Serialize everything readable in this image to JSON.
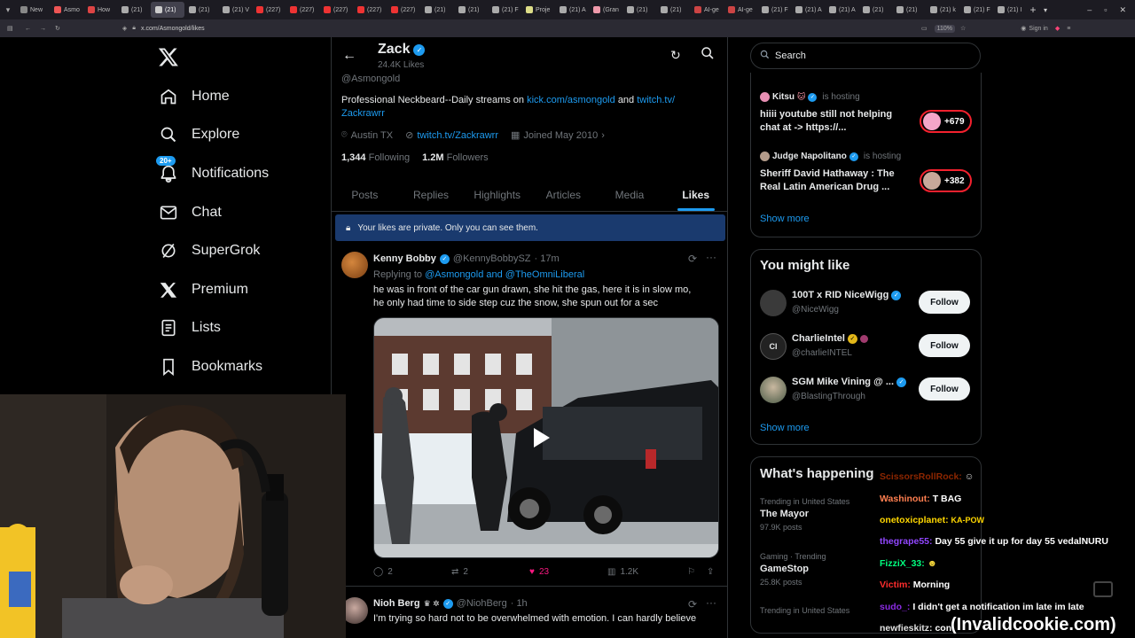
{
  "browser": {
    "tabs": [
      "New",
      "Asmo",
      "How",
      "(21)",
      "(21)",
      "(21)",
      "(21) V",
      "(227)",
      "(227)",
      "(227)",
      "(227)",
      "(227)",
      "(21)",
      "(21)",
      "(21) F",
      "Proje",
      "(21) A",
      "(Gran",
      "(21)",
      "(21)",
      "AI-ge",
      "AI-ge",
      "(21) F",
      "(21) A",
      "(21) A",
      "(21)",
      "(21)",
      "(21) k",
      "(21) F",
      "(21) I"
    ],
    "url": "x.com/Asmongold/likes",
    "zoom": "110%",
    "signin": "Sign in"
  },
  "nav": {
    "home": "Home",
    "explore": "Explore",
    "notifications": "Notifications",
    "notifications_badge": "20+",
    "chat": "Chat",
    "supergrok": "SuperGrok",
    "premium": "Premium",
    "lists": "Lists",
    "bookmarks": "Bookmarks"
  },
  "profile": {
    "name": "Zack",
    "likes_count": "24.4K Likes",
    "handle": "@Asmongold",
    "bio_prefix": "Professional Neckbeard--Daily streams on",
    "bio_link1": "kick.com/asmongold",
    "bio_and": "and",
    "bio_link2": "twitch.tv/",
    "bio_link2b": "Zackrawrr",
    "location": "Austin TX",
    "website": "twitch.tv/Zackrawrr",
    "joined": "Joined May 2010",
    "following_count": "1,344",
    "following_label": "Following",
    "followers_count": "1.2M",
    "followers_label": "Followers",
    "tabs": [
      "Posts",
      "Replies",
      "Highlights",
      "Articles",
      "Media",
      "Likes"
    ],
    "private_notice": "Your likes are private. Only you can see them."
  },
  "tweet1": {
    "name": "Kenny Bobby",
    "handle": "@KennyBobbySZ",
    "time": "· 17m",
    "replying_prefix": "Replying to",
    "replying_users": "@Asmongold and @TheOmniLiberal",
    "text_line1": "he was in front of the car gun drawn, she hit the gas, here it is in slow mo,",
    "text_line2": "he only had time to side step cuz the snow, she spun out for a sec",
    "replies": "2",
    "reposts": "2",
    "likes": "23",
    "views": "1.2K"
  },
  "tweet2": {
    "name": "Nioh Berg",
    "handle": "@NiohBerg",
    "time": "· 1h",
    "text": "I'm trying so hard not to be overwhelmed with emotion. I can hardly believe"
  },
  "search": {
    "placeholder": "Search"
  },
  "spaces": {
    "items": [
      {
        "host": "Kitsu",
        "status": "is hosting",
        "title1": "hiiii youtube still not helping",
        "title2": "chat at -> https://...",
        "count": "+679"
      },
      {
        "host": "Judge Napolitano",
        "status": "is hosting",
        "title1": "Sheriff David Hathaway : The",
        "title2": "Real Latin American Drug ...",
        "count": "+382"
      }
    ],
    "show_more": "Show more"
  },
  "suggest": {
    "title": "You might like",
    "users": [
      {
        "name": "100T x RID NiceWigg",
        "handle": "@NiceWigg",
        "button": "Follow"
      },
      {
        "name": "CharlieIntel",
        "handle": "@charlieINTEL",
        "button": "Follow"
      },
      {
        "name": "SGM Mike Vining @ ...",
        "handle": "@BlastingThrough",
        "button": "Follow"
      }
    ],
    "show_more": "Show more"
  },
  "happening": {
    "title": "What's happening",
    "items": [
      {
        "context": "Trending in United States",
        "topic": "The Mayor",
        "posts": "97.9K posts"
      },
      {
        "context": "Gaming · Trending",
        "topic": "GameStop",
        "posts": "25.8K posts"
      },
      {
        "context": "Trending in United States",
        "topic": "",
        "posts": ""
      }
    ]
  },
  "chat": {
    "lines": [
      {
        "user": "ScissorsRollRock:",
        "msg": "",
        "color": "#ff4500"
      },
      {
        "user": "Washinout:",
        "msg": "T BAG",
        "color": "#ff7f50"
      },
      {
        "user": "onetoxicplanet:",
        "msg": "",
        "color": "#ffd700"
      },
      {
        "user": "thegrape55:",
        "msg": "Day 55 give it up for day 55 vedalNURU",
        "color": "#9146ff"
      },
      {
        "user": "FizziX_33:",
        "msg": "",
        "color": "#00ff7f"
      },
      {
        "user": "Victim:",
        "msg": "Morning",
        "color": "#ff2d2d"
      },
      {
        "user": "sudo_:",
        "msg": "I didn't get a notification im late im late",
        "color": "#8a2be2"
      },
      {
        "user": "newfieskitz:",
        "msg": "con",
        "color": "#e0e0e0"
      }
    ],
    "watermark": "(Invalidcookie.com)"
  },
  "colors": {
    "accent": "#1d9bf0",
    "like": "#f91880",
    "verified_gold": "#e2b719"
  }
}
